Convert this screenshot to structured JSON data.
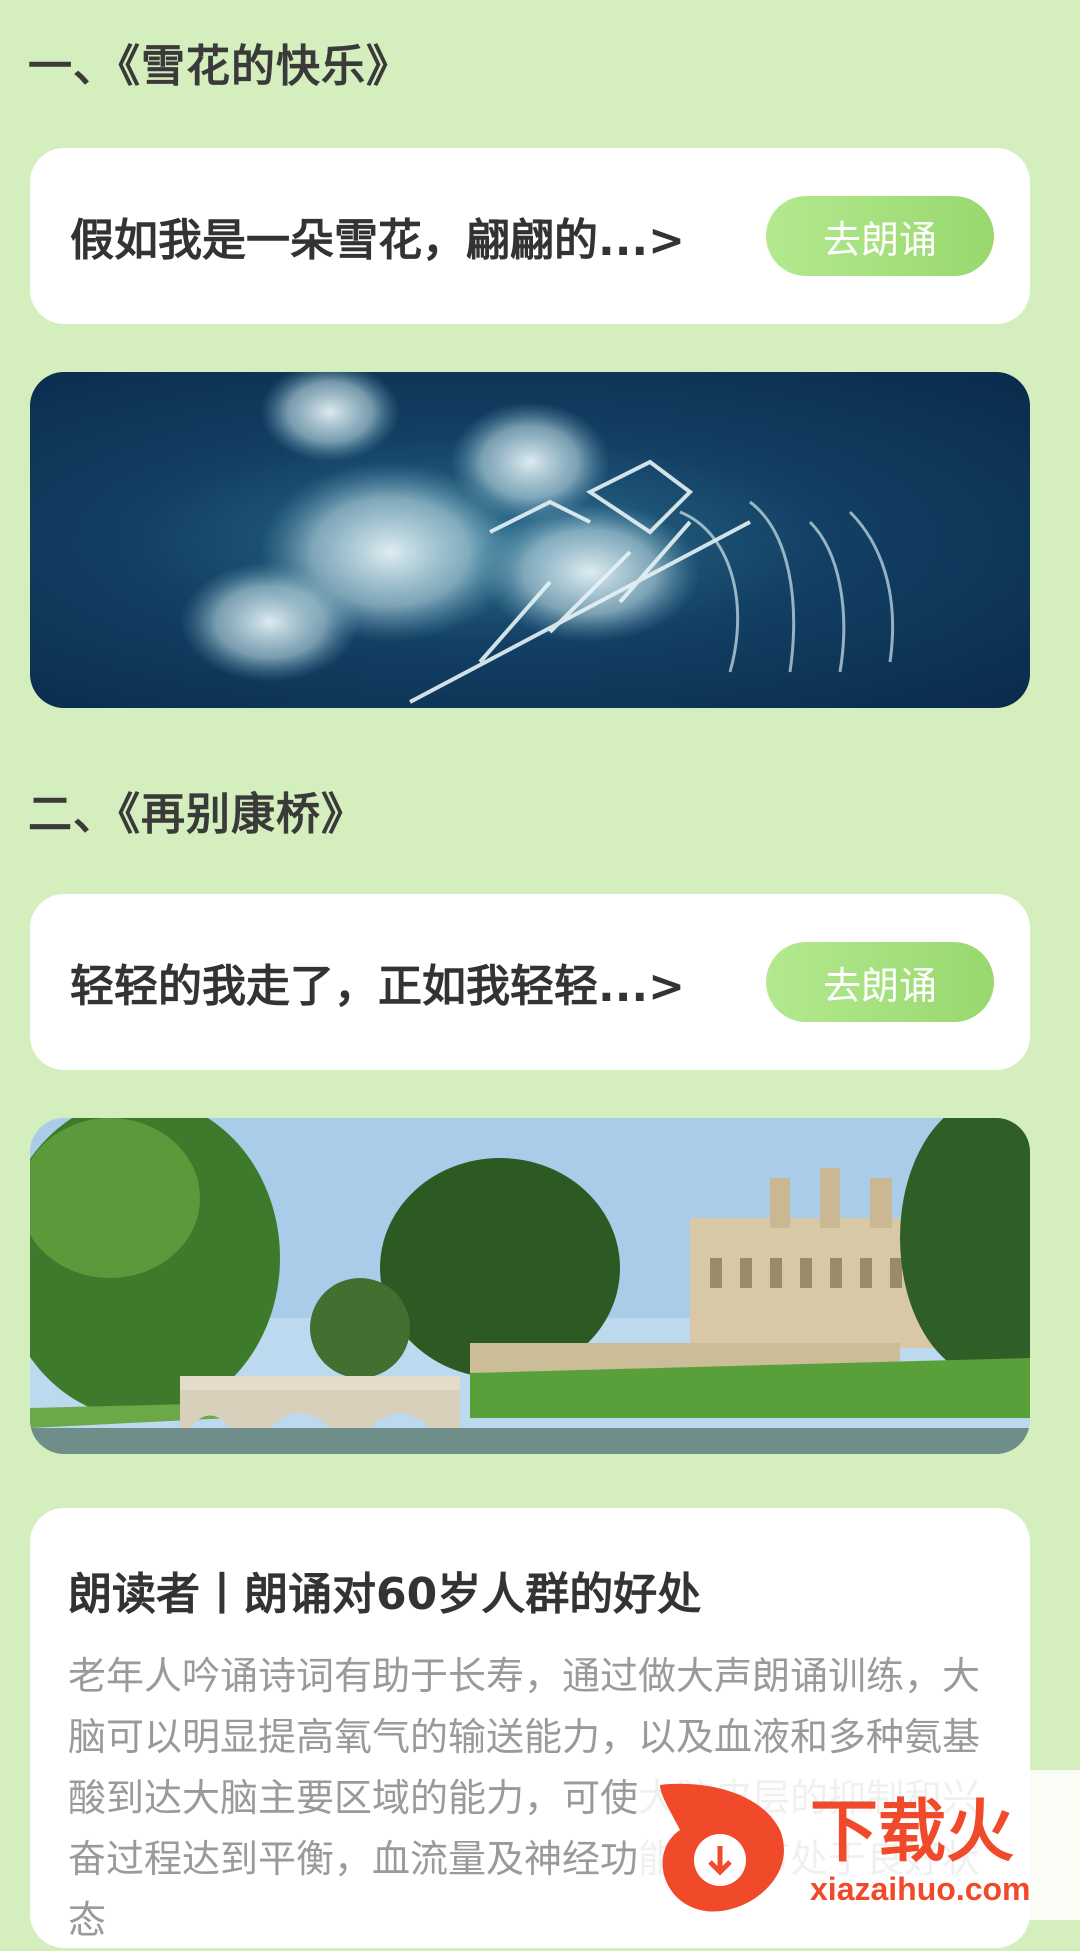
{
  "sections": [
    {
      "title": "一、《雪花的快乐》",
      "excerpt": "假如我是一朵雪花，翩翩的...>",
      "button": "去朗诵",
      "image_desc": "snowflake"
    },
    {
      "title": "二、《再别康桥》",
      "excerpt": "轻轻的我走了，正如我轻轻...>",
      "button": "去朗诵",
      "image_desc": "bridge"
    }
  ],
  "article": {
    "title": "朗读者丨朗诵对60岁人群的好处",
    "body": "老年人吟诵诗词有助于长寿，通过做大声朗诵训练，大脑可以明显提高氧气的输送能力，以及血液和多种氨基酸到达大脑主要区域的能力，可使大脑皮层的抑制和兴奋过程达到平衡，血流量及神经功能的调节处于良好状态"
  },
  "watermark": {
    "brand": "下载火",
    "url": "xiazaihuo.com"
  },
  "colors": {
    "background": "#d4efbd",
    "button": "#a8e07f",
    "card": "#ffffff"
  }
}
